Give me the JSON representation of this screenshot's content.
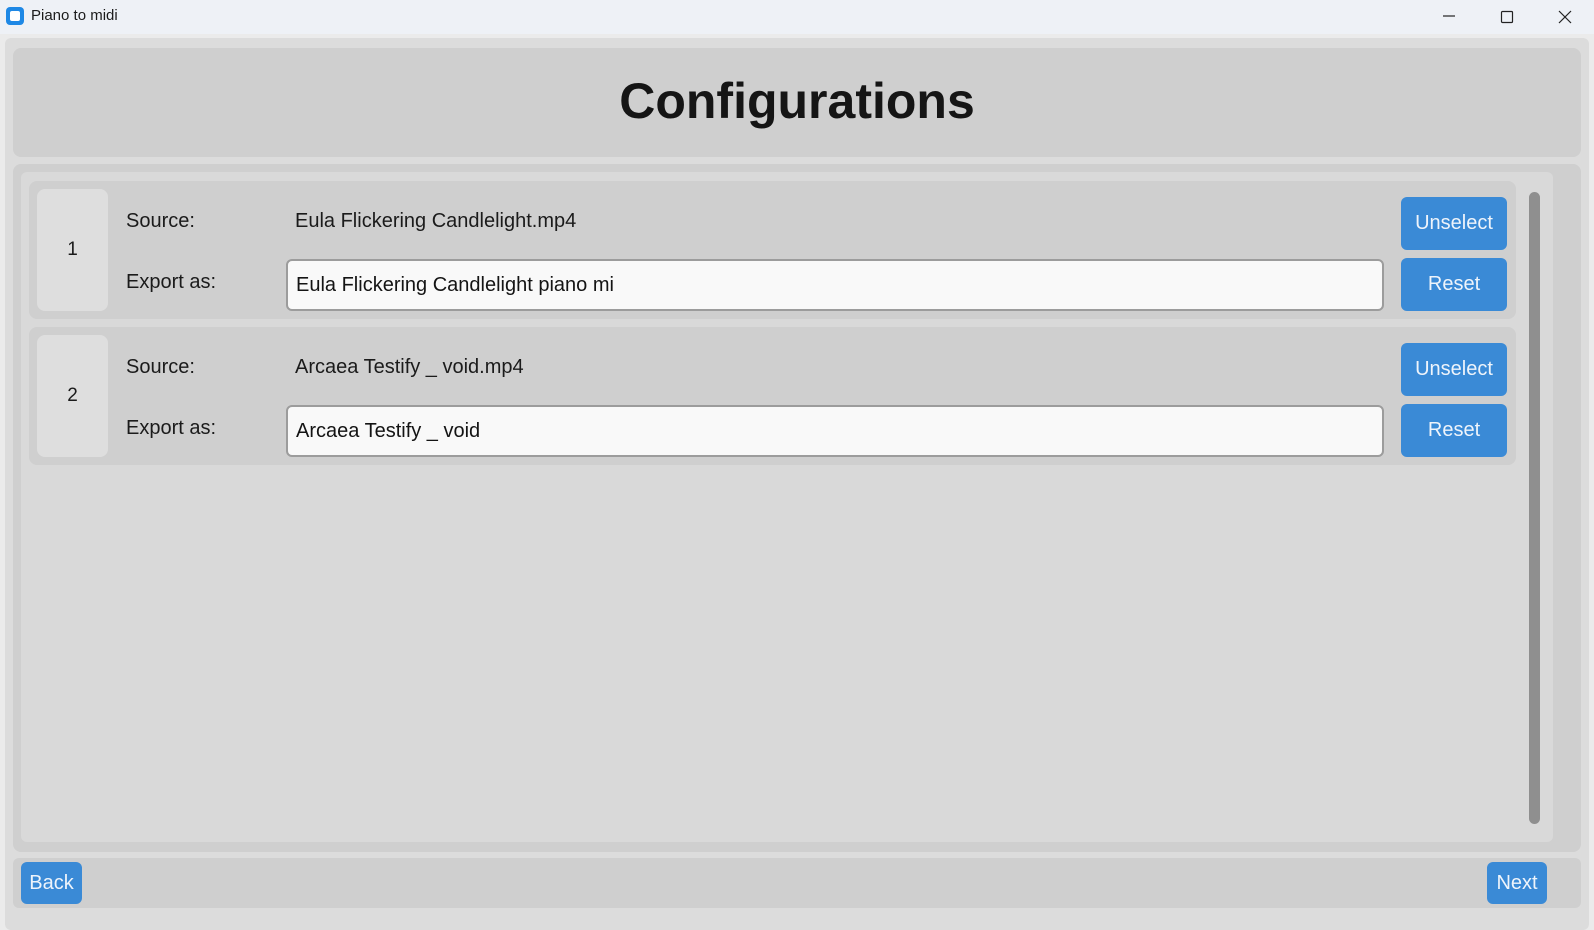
{
  "window": {
    "title": "Piano to midi",
    "controls": [
      "minimize-icon",
      "maximize-icon",
      "close-icon"
    ]
  },
  "header": {
    "title": "Configurations"
  },
  "labels": {
    "source": "Source:",
    "export": "Export as:"
  },
  "items": [
    {
      "number": "1",
      "source": "Eula Flickering Candlelight.mp4",
      "export_value": "Eula Flickering Candlelight piano mi",
      "unselect_label": "Unselect",
      "reset_label": "Reset"
    },
    {
      "number": "2",
      "source": "Arcaea Testify _ void.mp4",
      "export_value": "Arcaea Testify _ void",
      "unselect_label": "Unselect",
      "reset_label": "Reset"
    }
  ],
  "footer": {
    "back_label": "Back",
    "next_label": "Next"
  },
  "colors": {
    "accent": "#3a8ad6",
    "panel": "#cfcfcf",
    "background": "#d9d9d9"
  }
}
